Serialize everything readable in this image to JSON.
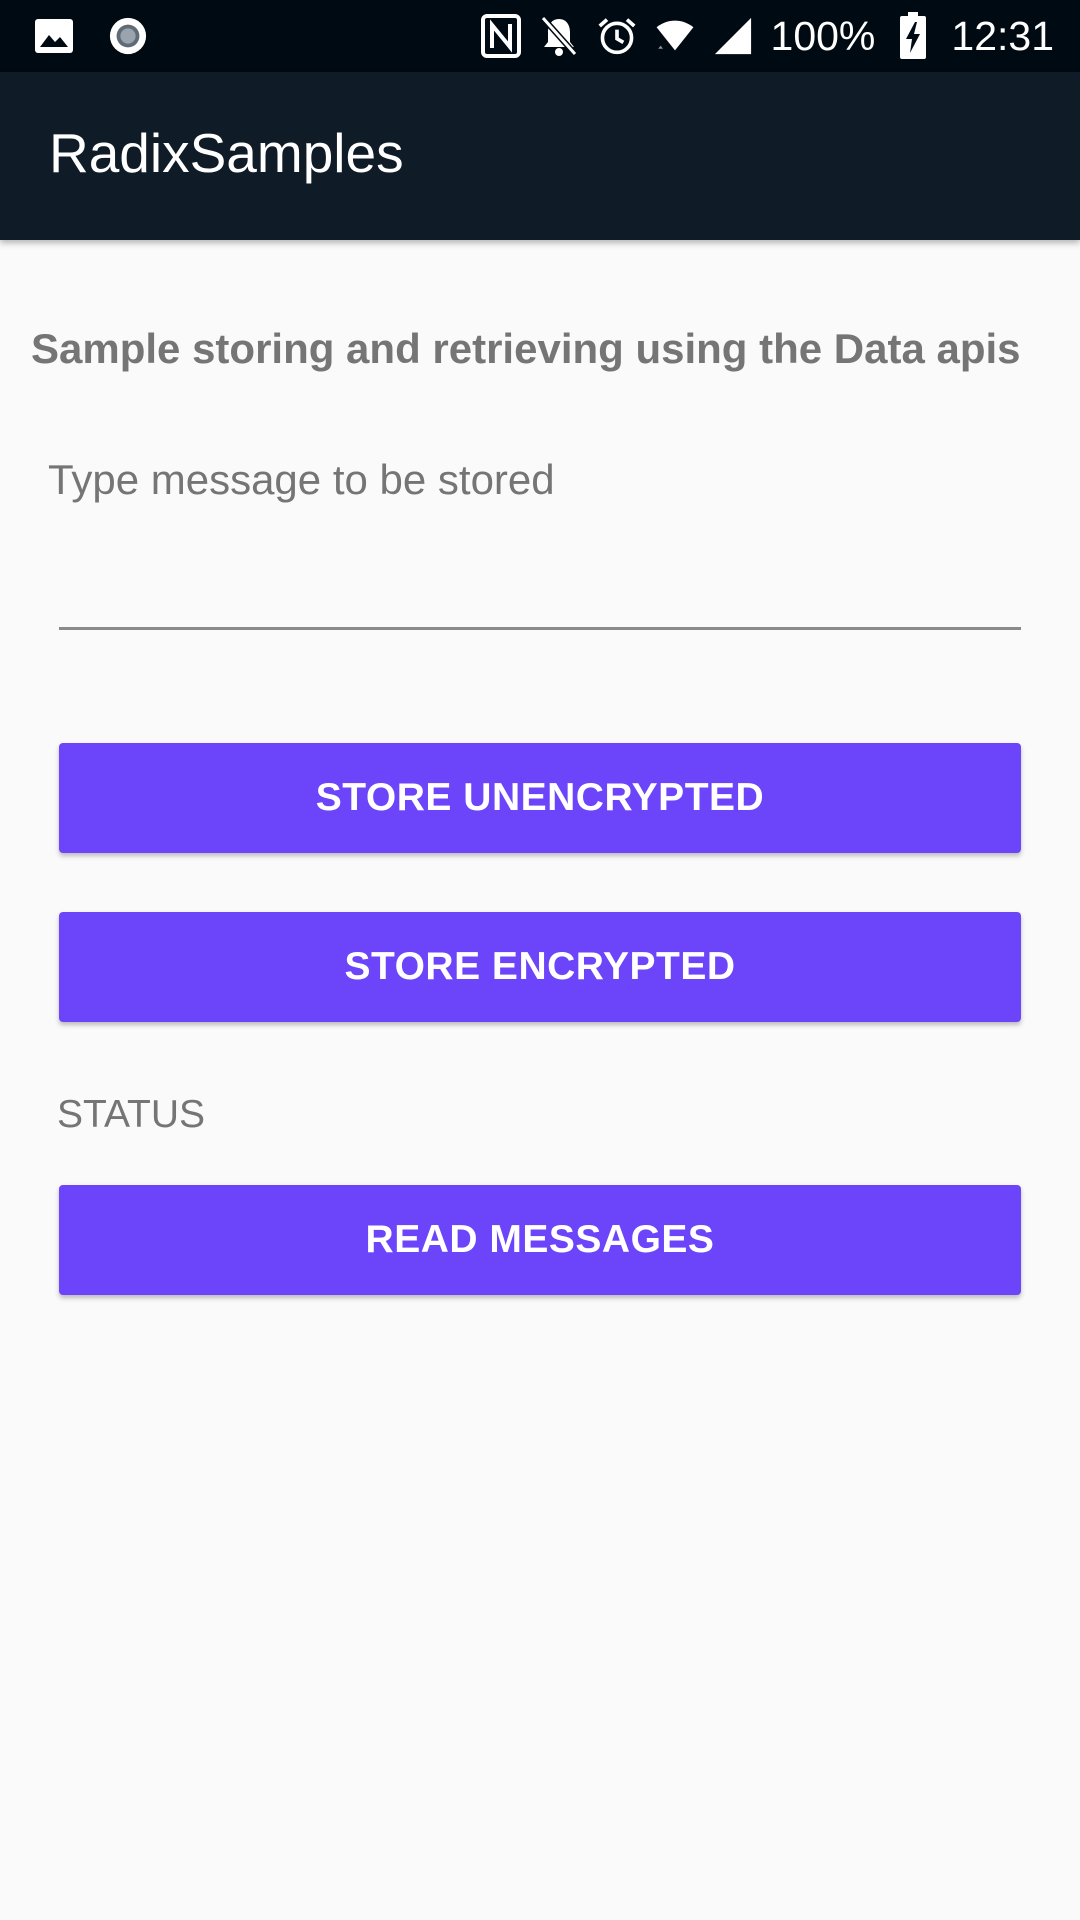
{
  "status_bar": {
    "left_icons": [
      "image-icon",
      "record-icon"
    ],
    "right_icons": [
      "nfc-icon",
      "notifications-off-icon",
      "alarm-icon",
      "wifi-icon",
      "signal-icon"
    ],
    "battery_percent": "100%",
    "battery_icon": "battery-charging-icon",
    "time": "12:31"
  },
  "app_bar": {
    "title": "RadixSamples"
  },
  "main": {
    "heading": "Sample storing and retrieving using the Data apis",
    "message_input": {
      "placeholder": "Type message to be stored",
      "value": ""
    },
    "store_unencrypted_label": "STORE UNENCRYPTED",
    "store_encrypted_label": "STORE ENCRYPTED",
    "status_text": "STATUS",
    "read_messages_label": "READ MESSAGES"
  },
  "colors": {
    "status_bar_bg": "#000a12",
    "app_bar_bg": "#0f1b27",
    "accent": "#6c44fa",
    "background": "#fafafa",
    "secondary_text": "#757575"
  }
}
